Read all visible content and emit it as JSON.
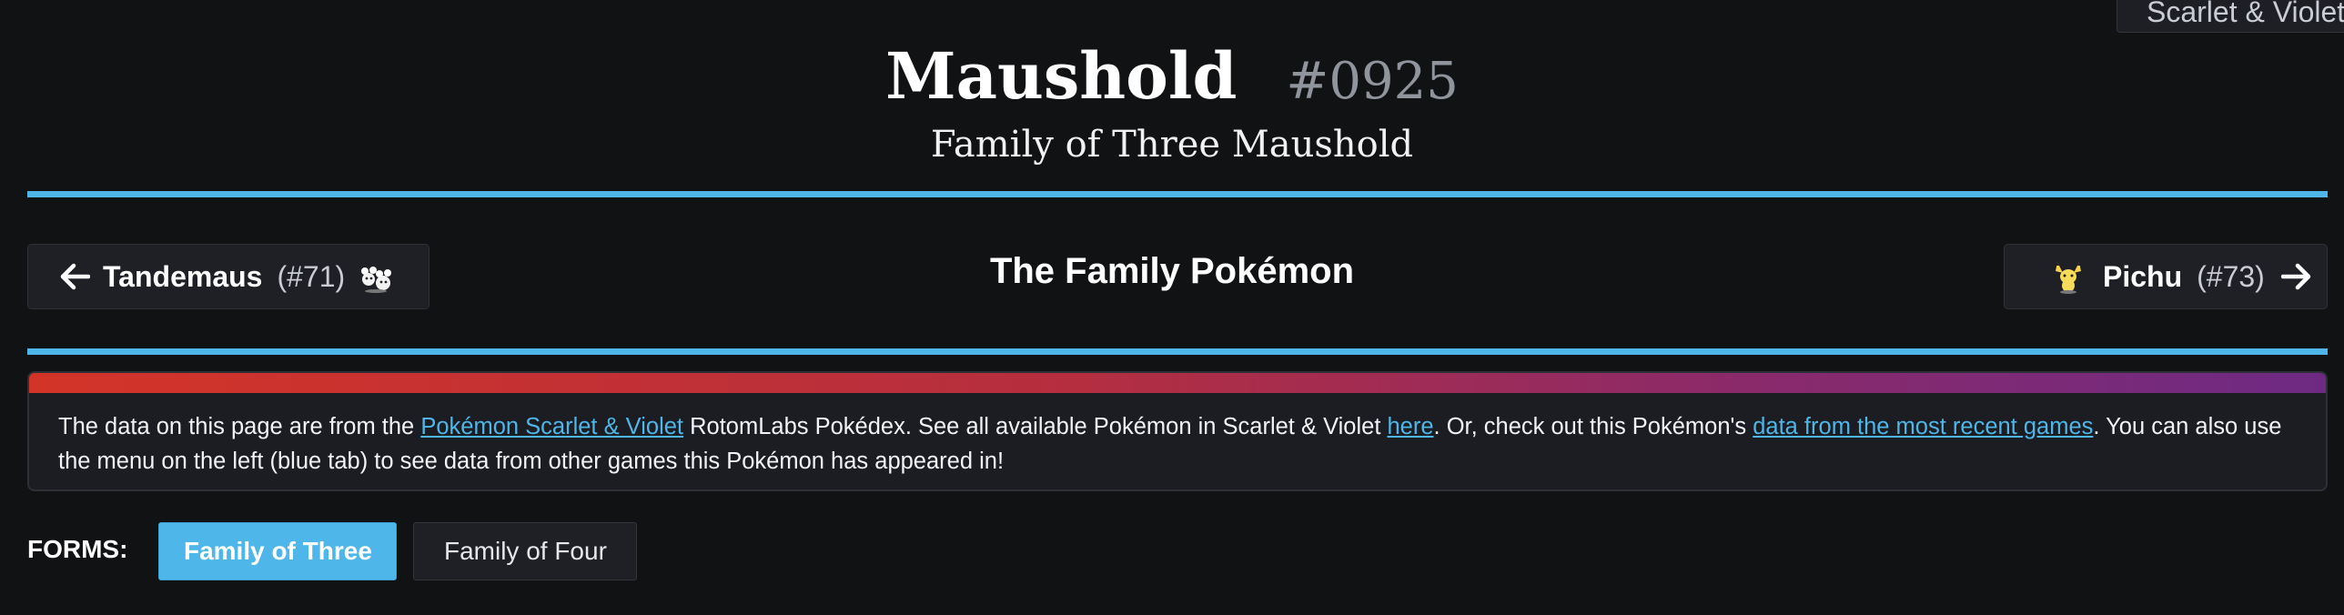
{
  "version_tab": {
    "label": "Scarlet & Violet"
  },
  "header": {
    "name": "Maushold",
    "number": "#0925",
    "form_name": "Family of Three Maushold"
  },
  "navigation": {
    "previous": {
      "name": "Tandemaus",
      "number": "(#71)",
      "sprite_icon": "tandemaus-sprite-icon",
      "arrow_icon": "arrow-left-icon"
    },
    "next": {
      "name": "Pichu",
      "number": "(#73)",
      "sprite_icon": "pichu-sprite-icon",
      "arrow_icon": "arrow-right-icon"
    }
  },
  "species": "The Family Pokémon",
  "notice": {
    "text_1": "The data on this page are from the ",
    "link_1": "Pokémon Scarlet & Violet",
    "text_2": " RotomLabs Pokédex. See all available Pokémon in Scarlet & Violet ",
    "link_2": "here",
    "text_3": ". Or, check out this Pokémon's ",
    "link_3": "data from the most recent games",
    "text_4": ". You can also use the menu on the left (blue tab) to see data from other games this Pokémon has appeared in!"
  },
  "forms": {
    "label": "FORMS:",
    "options": [
      {
        "label": "Family of Three",
        "active": true
      },
      {
        "label": "Family of Four",
        "active": false
      }
    ]
  },
  "colors": {
    "accent_blue": "#4eb6e8",
    "background": "#111214",
    "gradient_start": "#d33428",
    "gradient_end": "#6e2a83"
  }
}
